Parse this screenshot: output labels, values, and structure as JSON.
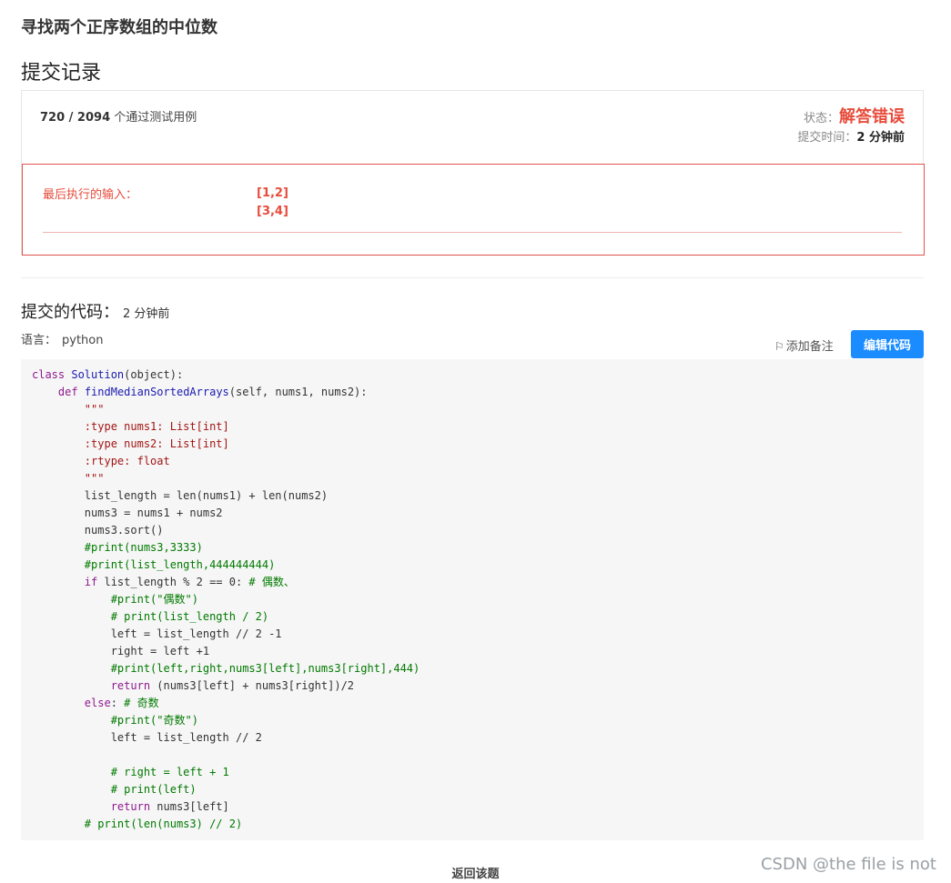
{
  "problem_title": "寻找两个正序数组的中位数",
  "section_title": "提交记录",
  "result": {
    "passed": "720 / 2094",
    "passed_suffix": "个通过测试用例",
    "status_label": "状态：",
    "status_value": "解答错误",
    "time_label": "提交时间：",
    "time_value": "2 分钟前"
  },
  "error": {
    "last_input_label": "最后执行的输入：",
    "inputs": [
      "[1,2]",
      "[3,4]"
    ]
  },
  "code_section": {
    "title": "提交的代码：",
    "time": "2 分钟前",
    "lang_label": "语言：",
    "lang_value": "python",
    "add_note": "添加备注",
    "edit_button": "编辑代码"
  },
  "code_lines": [
    "class Solution(object):",
    "    def findMedianSortedArrays(self, nums1, nums2):",
    "        \"\"\"",
    "        :type nums1: List[int]",
    "        :type nums2: List[int]",
    "        :rtype: float",
    "        \"\"\"",
    "        list_length = len(nums1) + len(nums2)",
    "        nums3 = nums1 + nums2",
    "        nums3.sort()",
    "        #print(nums3,3333)",
    "        #print(list_length,444444444)",
    "        if list_length % 2 == 0: # 偶数、",
    "            #print(\"偶数\")",
    "            # print(list_length / 2)",
    "            left = list_length // 2 -1",
    "            right = left +1",
    "            #print(left,right,nums3[left],nums3[right],444)",
    "            return (nums3[left] + nums3[right])/2",
    "        else: # 奇数",
    "            #print(\"奇数\")",
    "            left = list_length // 2",
    "",
    "            # right = left + 1",
    "            # print(left)",
    "            return nums3[left]",
    "        # print(len(nums3) // 2)"
  ],
  "back_link": "返回该题",
  "watermark": "CSDN @the file is not",
  "colors": {
    "error": "#e74c3c",
    "primary_button": "#1a8cff",
    "code_background": "#f6f6f6"
  }
}
